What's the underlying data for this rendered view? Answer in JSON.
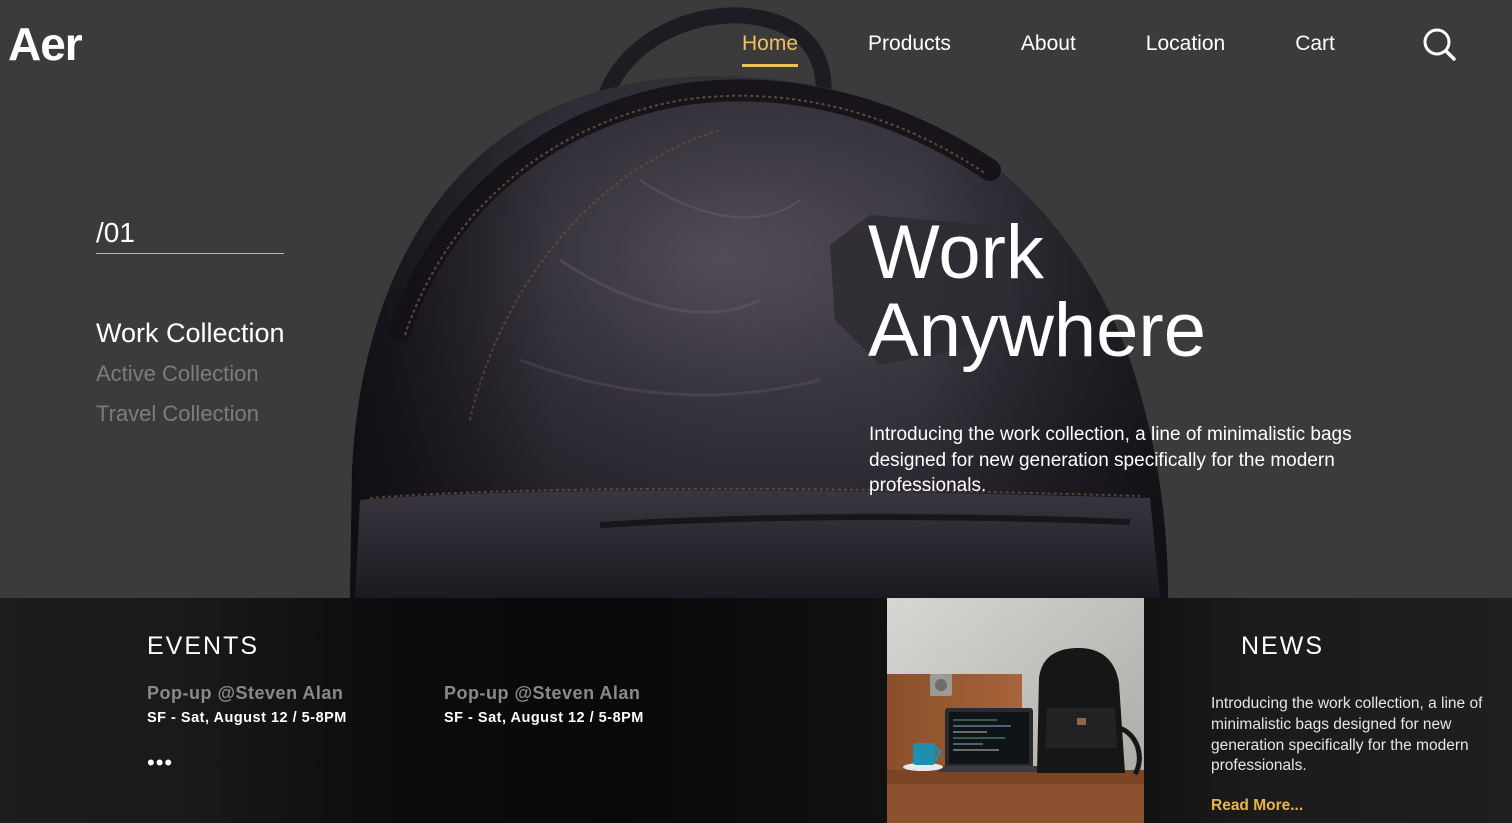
{
  "header": {
    "logo": "Aer",
    "nav": [
      {
        "label": "Home",
        "active": true
      },
      {
        "label": "Products",
        "active": false
      },
      {
        "label": "About",
        "active": false
      },
      {
        "label": "Location",
        "active": false
      },
      {
        "label": "Cart",
        "active": false
      }
    ],
    "search_icon": "search-icon"
  },
  "hero": {
    "slide_index": "/01",
    "collections": [
      {
        "label": "Work Collection",
        "active": true
      },
      {
        "label": "Active Collection",
        "active": false
      },
      {
        "label": "Travel Collection",
        "active": false
      }
    ],
    "title_line1": "Work",
    "title_line2": "Anywhere",
    "description": "Introducing the work collection, a line of minimalistic bags designed for new generation specifically for the modern professionals."
  },
  "events": {
    "title": "EVENTS",
    "items": [
      {
        "name": "Pop-up @Steven Alan",
        "detail": "SF - Sat, August 12 / 5-8PM"
      },
      {
        "name": "Pop-up @Steven Alan",
        "detail": "SF - Sat, August 12 / 5-8PM"
      }
    ],
    "more": "•••"
  },
  "news": {
    "title": "NEWS",
    "text": "Introducing the work collection, a line of minimalistic bags designed for new generation specifically for the modern professionals.",
    "read_more": "Read More..."
  },
  "colors": {
    "accent": "#f0c060",
    "background": "#3b3b3b",
    "bottom_bar": "#1c1c1c",
    "read_more": "#e8b74a"
  }
}
